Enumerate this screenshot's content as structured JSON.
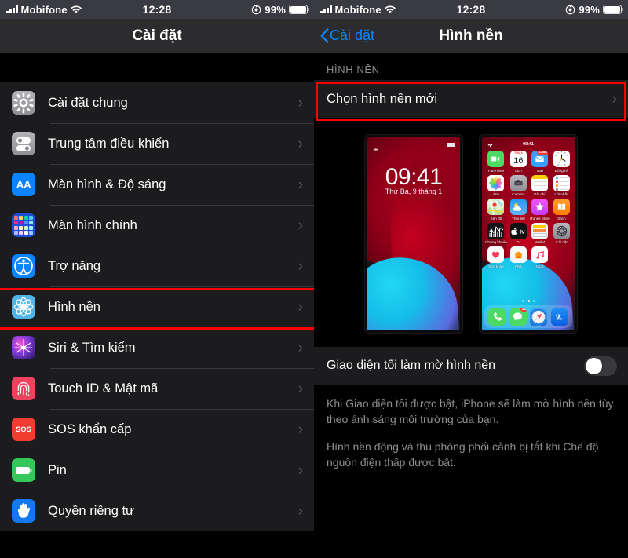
{
  "statusbar": {
    "carrier": "Mobifone",
    "time": "12:28",
    "battery_pct": "99%",
    "signal_icon": "cellular-signal-icon",
    "wifi_icon": "wifi-icon",
    "battery_icon": "battery-full-icon",
    "moon_icon": "do-not-disturb-icon"
  },
  "left_pane": {
    "nav_title": "Cài đặt",
    "items": [
      {
        "label": "Cài đặt chung",
        "icon": "gear-icon",
        "icon_class": "ic-gen",
        "chevron": "›"
      },
      {
        "label": "Trung tâm điều khiển",
        "icon": "control-center-icon",
        "icon_class": "ic-cc",
        "chevron": "›"
      },
      {
        "label": "Màn hình & Độ sáng",
        "icon": "display-brightness-icon",
        "icon_class": "ic-disp",
        "glyph": "AA",
        "chevron": "›"
      },
      {
        "label": "Màn hình chính",
        "icon": "home-screen-icon",
        "icon_class": "ic-home",
        "chevron": "›"
      },
      {
        "label": "Trợ năng",
        "icon": "accessibility-icon",
        "icon_class": "ic-acc",
        "chevron": "›"
      },
      {
        "label": "Hình nền",
        "icon": "wallpaper-icon",
        "icon_class": "ic-wall",
        "chevron": "›",
        "highlighted": true
      },
      {
        "label": "Siri & Tìm kiếm",
        "icon": "siri-icon",
        "icon_class": "ic-siri",
        "chevron": "›"
      },
      {
        "label": "Touch ID & Mật mã",
        "icon": "touch-id-icon",
        "icon_class": "ic-touch",
        "chevron": "›"
      },
      {
        "label": "SOS khẩn cấp",
        "icon": "sos-icon",
        "icon_class": "ic-sos",
        "glyph": "SOS",
        "chevron": "›"
      },
      {
        "label": "Pin",
        "icon": "battery-icon",
        "icon_class": "ic-batt",
        "chevron": "›"
      },
      {
        "label": "Quyền riêng tư",
        "icon": "privacy-hand-icon",
        "icon_class": "ic-priv",
        "chevron": "›"
      }
    ]
  },
  "right_pane": {
    "back_label": "Cài đặt",
    "nav_title": "Hình nền",
    "section_header": "HÌNH NỀN",
    "choose_row": {
      "label": "Chọn hình nền mới",
      "chevron": "›",
      "highlighted": true
    },
    "previews": {
      "lock": {
        "name": "lock-screen-preview",
        "time": "09:41",
        "date": "Thứ Ba, 9 tháng 1"
      },
      "home": {
        "name": "home-screen-preview",
        "time": "09:41",
        "apps": [
          {
            "label": "FaceTime",
            "icon": "facetime-icon"
          },
          {
            "label": "Lịch",
            "icon": "calendar-icon",
            "day": "16",
            "weekday": "THỨ 6"
          },
          {
            "label": "Mail",
            "icon": "mail-icon",
            "badge": "1.562"
          },
          {
            "label": "Đồng hồ",
            "icon": "clock-icon"
          },
          {
            "label": "Ảnh",
            "icon": "photos-icon"
          },
          {
            "label": "Camera",
            "icon": "camera-icon"
          },
          {
            "label": "Ghi chú",
            "icon": "notes-icon"
          },
          {
            "label": "Lời nhắc",
            "icon": "reminders-icon"
          },
          {
            "label": "Bản đồ",
            "icon": "maps-icon"
          },
          {
            "label": "Thời tiết",
            "icon": "weather-icon"
          },
          {
            "label": "iTunes Store",
            "icon": "itunes-store-icon"
          },
          {
            "label": "Sách",
            "icon": "books-icon"
          },
          {
            "label": "Chứng khoán",
            "icon": "stocks-icon"
          },
          {
            "label": "TV",
            "icon": "apple-tv-icon"
          },
          {
            "label": "Wallet",
            "icon": "wallet-icon"
          },
          {
            "label": "Cài đặt",
            "icon": "settings-gear-icon"
          },
          {
            "label": "Sức khỏe",
            "icon": "health-icon"
          },
          {
            "label": "Nhà",
            "icon": "home-app-icon"
          },
          {
            "label": "Nhạc",
            "icon": "music-icon"
          }
        ],
        "dock": [
          {
            "label": "Điện thoại",
            "icon": "phone-icon"
          },
          {
            "label": "Tin nhắn",
            "icon": "messages-icon",
            "badge": "22"
          },
          {
            "label": "Safari",
            "icon": "safari-icon"
          },
          {
            "label": "App Store",
            "icon": "app-store-icon"
          }
        ],
        "page_dots": 3,
        "active_dot": 1
      }
    },
    "dark_toggle": {
      "label": "Giao diện tối làm mờ hình nền",
      "state": "off"
    },
    "footer": [
      "Khi Giao diện tối được bật, iPhone sẽ làm mờ hình nền tùy theo ánh sáng môi trường của bạn.",
      "Hình nền động và thu phóng phối cảnh bị tắt khi Chế độ nguồn điện thấp được bật."
    ]
  },
  "colors": {
    "accent_blue": "#0a84ff",
    "highlight_red": "#ff0000",
    "list_bg": "#1c1c1e",
    "nav_bg": "#2c2c2e",
    "secondary_text": "#8e8e93"
  }
}
